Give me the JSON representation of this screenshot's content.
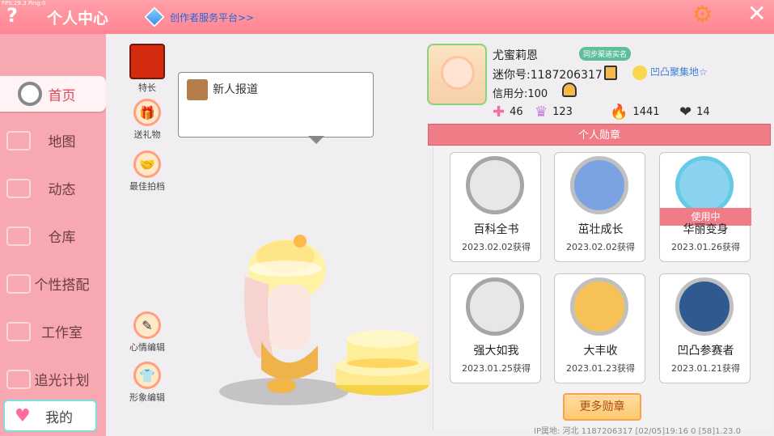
{
  "topbar": {
    "fps": "FPS:29.3 Ping:0",
    "help_icon": "question-icon",
    "title": "个人中心",
    "creator_link": "创作者服务平台>>"
  },
  "sidebar": {
    "items": [
      {
        "label": "首页",
        "active": true
      },
      {
        "label": "地图"
      },
      {
        "label": "动态"
      },
      {
        "label": "仓库"
      },
      {
        "label": "个性搭配"
      },
      {
        "label": "工作室"
      },
      {
        "label": "追光计划"
      }
    ],
    "me_label": "我的"
  },
  "main": {
    "shortcuts": {
      "specialty": "特长",
      "send_gift": "送礼物",
      "best_photo": "最佳拍档",
      "mood_edit": "心情编辑",
      "image_edit": "形象编辑"
    },
    "bubble_text": "新人报道"
  },
  "profile": {
    "name": "尤蜜莉恩",
    "sync_badge": "同步渠道实名",
    "mini_id": "迷你号:1187206317",
    "guild": "凹凸聚集地☆",
    "credit": "信用分:100",
    "stats": [
      {
        "icon": "plus-icon",
        "value": "46"
      },
      {
        "icon": "crown-icon",
        "value": "123"
      },
      {
        "icon": "fire-icon",
        "value": "1441"
      },
      {
        "icon": "heart-icon",
        "value": "14"
      }
    ]
  },
  "medals": {
    "title": "个人勋章",
    "items": [
      {
        "name": "百科全书",
        "date": "2023.02.02获得"
      },
      {
        "name": "茁壮成长",
        "date": "2023.02.02获得"
      },
      {
        "name": "华丽变身",
        "date": "2023.01.26获得",
        "tag": "使用中"
      },
      {
        "name": "强大如我",
        "date": "2023.01.25获得"
      },
      {
        "name": "大丰收",
        "date": "2023.01.23获得"
      },
      {
        "name": "凹凸参赛者",
        "date": "2023.01.21获得"
      }
    ],
    "more_button": "更多勋章"
  },
  "footer": "IP属地: 河北   1187206317  [02/05]19:16 0  [58]1.23.0"
}
